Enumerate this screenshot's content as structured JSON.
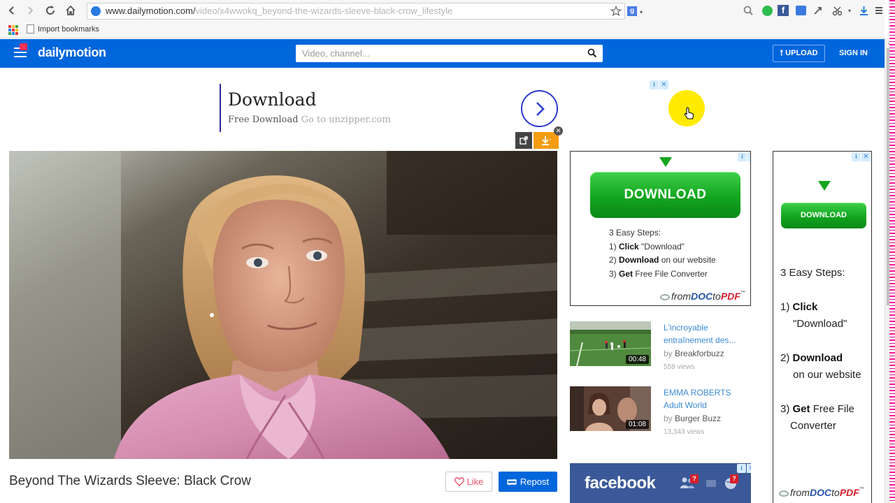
{
  "browser": {
    "url_host": "www.dailymotion.com/",
    "url_path": "video/x4wwokq_beyond-the-wizards-sleeve-black-crow_lifestyle",
    "bookmark_label": "Import bookmarks"
  },
  "header": {
    "logo": "dailymotion",
    "search_placeholder": "Video, channel...",
    "upload_label": "UPLOAD",
    "signin_label": "SIGN IN",
    "brand_color": "#0066dc"
  },
  "top_ad": {
    "title": "Download",
    "subtitle": "Free Download",
    "domain": "Go to unzipper.com"
  },
  "video": {
    "title": "Beyond The Wizards Sleeve: Black Crow",
    "like_label": "Like",
    "repost_label": "Repost"
  },
  "side_ad": {
    "button_label": "DOWNLOAD",
    "steps_heading": "3 Easy Steps:",
    "step1_num": "1)",
    "step1_bold": "Click",
    "step1_rest": "\"Download\"",
    "step2_num": "2)",
    "step2_bold": "Download",
    "step2_rest": "on our website",
    "step3_num": "3)",
    "step3_bold": "Get",
    "step3_rest": "Free File Converter",
    "step3_rest_a": "Free File",
    "step3_rest_b": "Converter",
    "brand_from": "from",
    "brand_doc": "DOC",
    "brand_to": "to",
    "brand_pdf": "PDF",
    "brand_tm": "™"
  },
  "related": [
    {
      "title": "L'incroyable entraînement des...",
      "by_prefix": "by",
      "channel": "Breakforbuzz",
      "views": "558 views",
      "duration": "00:48"
    },
    {
      "title": "EMMA ROBERTS Adult World",
      "by_prefix": "by",
      "channel": "Burger Buzz",
      "views": "13,343 views",
      "duration": "01:08"
    }
  ],
  "fb_ad": {
    "logo": "facebook",
    "notif": "?"
  }
}
